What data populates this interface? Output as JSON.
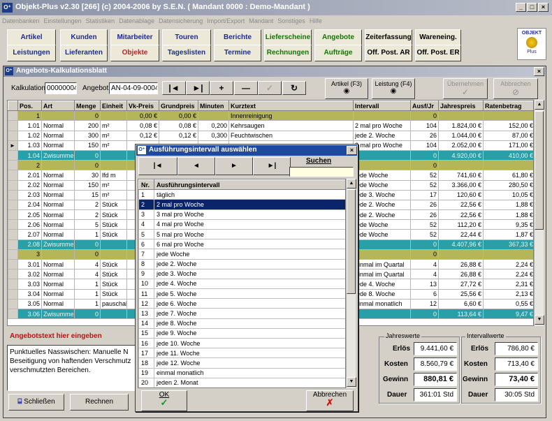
{
  "window": {
    "title": "Objekt-Plus v2.30 [266]     (c) 2004-2006 by S.E.N.     ( Mandant 0000 : Demo-Mandant )",
    "min": "_",
    "max": "□",
    "close": "×"
  },
  "menu": [
    "Datenbanken",
    "Einstellungen",
    "Statistiken",
    "Datenablage",
    "Datensicherung",
    "Import/Export",
    "Mandant",
    "Sonstiges",
    "Hilfe"
  ],
  "nav_row1": [
    {
      "label": "Artikel",
      "color": "blue"
    },
    {
      "label": "Kunden",
      "color": "blue"
    },
    {
      "label": "Mitarbeiter",
      "color": "blue"
    },
    {
      "label": "Touren",
      "color": "blue"
    },
    {
      "label": "Berichte",
      "color": "blue"
    },
    {
      "label": "Lieferscheine",
      "color": "green"
    },
    {
      "label": "Angebote",
      "color": "green"
    },
    {
      "label": "Zeiterfassung",
      "color": "black"
    },
    {
      "label": "Wareneing.",
      "color": "black"
    }
  ],
  "nav_row2": [
    {
      "label": "Leistungen",
      "color": "blue"
    },
    {
      "label": "Lieferanten",
      "color": "blue"
    },
    {
      "label": "Objekte",
      "color": "red"
    },
    {
      "label": "Tageslisten",
      "color": "blue"
    },
    {
      "label": "Termine",
      "color": "blue"
    },
    {
      "label": "Rechnungen",
      "color": "green"
    },
    {
      "label": "Aufträge",
      "color": "green"
    },
    {
      "label": "Off. Post. AR",
      "color": "black"
    },
    {
      "label": "Off. Post. ER",
      "color": "black"
    }
  ],
  "logo": {
    "line1": "OBJEKT",
    "line2": "Plus"
  },
  "panel": {
    "title": "Angebots-Kalkulationsblatt",
    "close": "×"
  },
  "toolbar": {
    "kalk_label": "Kalkulation",
    "kalk_value": "00000004",
    "angebot_label": "Angebot",
    "angebot_value": "AN-04-09-0004",
    "first": "|◄",
    "prev": "►|",
    "add": "+",
    "remove": "—",
    "check": "✓",
    "refresh": "↻",
    "artikel": "Artikel (F3)",
    "leistung": "Leistung (F4)",
    "uebernehmen": "Übernehmen",
    "abbrechen": "Abbrechen"
  },
  "table": {
    "headers": [
      "Pos.",
      "Art",
      "Menge",
      "Einheit",
      "Vk-Preis",
      "Grundpreis",
      "Minuten",
      "Kurztext",
      "Intervall",
      "Ausf/Jr",
      "Jahrespreis",
      "Ratenbetrag"
    ],
    "rows": [
      {
        "t": "olive",
        "c": [
          "1",
          "",
          "0",
          "",
          "0,00 €",
          "0,00 €",
          "",
          "Innenreinigung",
          "",
          "0",
          "",
          ""
        ]
      },
      {
        "t": "",
        "c": [
          "1.01",
          "Normal",
          "200",
          "m²",
          "0,08 €",
          "0,08 €",
          "0,200",
          "Kehrsaugen",
          "2 mal pro Woche",
          "104",
          "1.824,00 €",
          "152,00 €"
        ]
      },
      {
        "t": "",
        "c": [
          "1.02",
          "Normal",
          "300",
          "m²",
          "0,12 €",
          "0,12 €",
          "0,300",
          "Feuchtwischen",
          "jede 2. Woche",
          "26",
          "1.044,00 €",
          "87,00 €"
        ]
      },
      {
        "t": "sel",
        "c": [
          "1.03",
          "Normal",
          "150",
          "m²",
          "",
          "",
          "",
          "",
          "2 mal pro Woche",
          "104",
          "2.052,00 €",
          "171,00 €"
        ]
      },
      {
        "t": "teal",
        "c": [
          "1.04",
          "Zwisumme",
          "0",
          "",
          "",
          "",
          "",
          "",
          "",
          "0",
          "4.920,00 €",
          "410,00 €"
        ]
      },
      {
        "t": "olive",
        "c": [
          "2",
          "",
          "0",
          "",
          "",
          "",
          "",
          "",
          "",
          "0",
          "",
          ""
        ]
      },
      {
        "t": "",
        "c": [
          "2.01",
          "Normal",
          "30",
          "lfd m",
          "",
          "",
          "",
          "",
          "jede Woche",
          "52",
          "741,60 €",
          "61,80 €"
        ]
      },
      {
        "t": "",
        "c": [
          "2.02",
          "Normal",
          "150",
          "m²",
          "",
          "",
          "",
          "",
          "jede Woche",
          "52",
          "3.366,00 €",
          "280,50 €"
        ]
      },
      {
        "t": "",
        "c": [
          "2.03",
          "Normal",
          "15",
          "m²",
          "",
          "",
          "",
          "",
          "jede 3. Woche",
          "17",
          "120,60 €",
          "10,05 €"
        ]
      },
      {
        "t": "",
        "c": [
          "2.04",
          "Normal",
          "2",
          "Stück",
          "",
          "",
          "",
          "",
          "jede 2. Woche",
          "26",
          "22,56 €",
          "1,88 €"
        ]
      },
      {
        "t": "",
        "c": [
          "2.05",
          "Normal",
          "2",
          "Stück",
          "",
          "",
          "",
          "",
          "jede 2. Woche",
          "26",
          "22,56 €",
          "1,88 €"
        ]
      },
      {
        "t": "",
        "c": [
          "2.06",
          "Normal",
          "5",
          "Stück",
          "",
          "",
          "",
          "",
          "jede Woche",
          "52",
          "112,20 €",
          "9,35 €"
        ]
      },
      {
        "t": "",
        "c": [
          "2.07",
          "Normal",
          "1",
          "Stück",
          "",
          "",
          "",
          "",
          "jede Woche",
          "52",
          "22,44 €",
          "1,87 €"
        ]
      },
      {
        "t": "teal",
        "c": [
          "2.08",
          "Zwisumme",
          "0",
          "",
          "",
          "",
          "",
          "",
          "",
          "0",
          "4.407,96 €",
          "367,33 €"
        ]
      },
      {
        "t": "olive",
        "c": [
          "3",
          "",
          "0",
          "",
          "",
          "",
          "",
          "",
          "",
          "0",
          "",
          ""
        ]
      },
      {
        "t": "",
        "c": [
          "3.01",
          "Normal",
          "4",
          "Stück",
          "",
          "",
          "",
          "",
          "einmal im Quartal",
          "4",
          "26,88 €",
          "2,24 €"
        ]
      },
      {
        "t": "",
        "c": [
          "3.02",
          "Normal",
          "4",
          "Stück",
          "",
          "",
          "",
          "",
          "einmal im Quartal",
          "4",
          "26,88 €",
          "2,24 €"
        ]
      },
      {
        "t": "",
        "c": [
          "3.03",
          "Normal",
          "1",
          "Stück",
          "",
          "",
          "",
          "",
          "jede 4. Woche",
          "13",
          "27,72 €",
          "2,31 €"
        ]
      },
      {
        "t": "",
        "c": [
          "3.04",
          "Normal",
          "1",
          "Stück",
          "",
          "",
          "",
          "",
          "jede 8. Woche",
          "6",
          "25,56 €",
          "2,13 €"
        ]
      },
      {
        "t": "",
        "c": [
          "3.05",
          "Normal",
          "1",
          "pauschal",
          "",
          "",
          "",
          "",
          "einmal monatlich",
          "12",
          "6,60 €",
          "0,55 €"
        ]
      },
      {
        "t": "teal",
        "c": [
          "3.06",
          "Zwisumme",
          "0",
          "",
          "",
          "",
          "",
          "",
          "",
          "0",
          "113,64 €",
          "9,47 €"
        ]
      }
    ]
  },
  "angebotstext": {
    "label": "Angebotstext hier eingeben",
    "text": "Punktuelles Nasswischen: Manuelle N\nBeseitigung von haftenden Verschmutz\nverschmutzten Bereichen."
  },
  "buttons": {
    "schliessen": "Schließen",
    "rechnen": "Rechnen"
  },
  "jahreswerte": {
    "title": "Jahreswerte",
    "erloes_l": "Erlös",
    "erloes": "9.441,60 €",
    "kosten_l": "Kosten",
    "kosten": "8.560,79 €",
    "gewinn_l": "Gewinn",
    "gewinn": "880,81 €",
    "dauer_l": "Dauer",
    "dauer": "361:01 Std"
  },
  "intervallwerte": {
    "title": "Intervallwerte",
    "erloes_l": "Erlös",
    "erloes": "786,80 €",
    "kosten_l": "Kosten",
    "kosten": "713,40 €",
    "gewinn_l": "Gewinn",
    "gewinn": "73,40 €",
    "dauer_l": "Dauer",
    "dauer": "30:05 Std"
  },
  "dialog": {
    "title": "Ausführungsintervall auswählen",
    "close": "×",
    "first": "|◄",
    "prev": "◄",
    "next": "►",
    "last": "►|",
    "suchen": "Suchen",
    "suchen_value": "",
    "col_nr": "Nr.",
    "col_name": "Ausführungsintervall",
    "ok": "OK",
    "abbrechen": "Abbrechen",
    "items": [
      [
        "1",
        "täglich"
      ],
      [
        "2",
        "2 mal pro Woche"
      ],
      [
        "3",
        "3 mal pro Woche"
      ],
      [
        "4",
        "4 mal pro Woche"
      ],
      [
        "5",
        "5 mal pro Woche"
      ],
      [
        "6",
        "6 mal pro Woche"
      ],
      [
        "7",
        "jede Woche"
      ],
      [
        "8",
        "jede 2. Woche"
      ],
      [
        "9",
        "jede 3. Woche"
      ],
      [
        "10",
        "jede 4. Woche"
      ],
      [
        "11",
        "jede 5. Woche"
      ],
      [
        "12",
        "jede 6. Woche"
      ],
      [
        "13",
        "jede 7. Woche"
      ],
      [
        "14",
        "jede 8. Woche"
      ],
      [
        "15",
        "jede 9. Woche"
      ],
      [
        "16",
        "jede 10. Woche"
      ],
      [
        "17",
        "jede 11. Woche"
      ],
      [
        "18",
        "jede 12. Woche"
      ],
      [
        "19",
        "einmal monatlich"
      ],
      [
        "20",
        "jeden 2. Monat"
      ]
    ],
    "selected": "2"
  }
}
